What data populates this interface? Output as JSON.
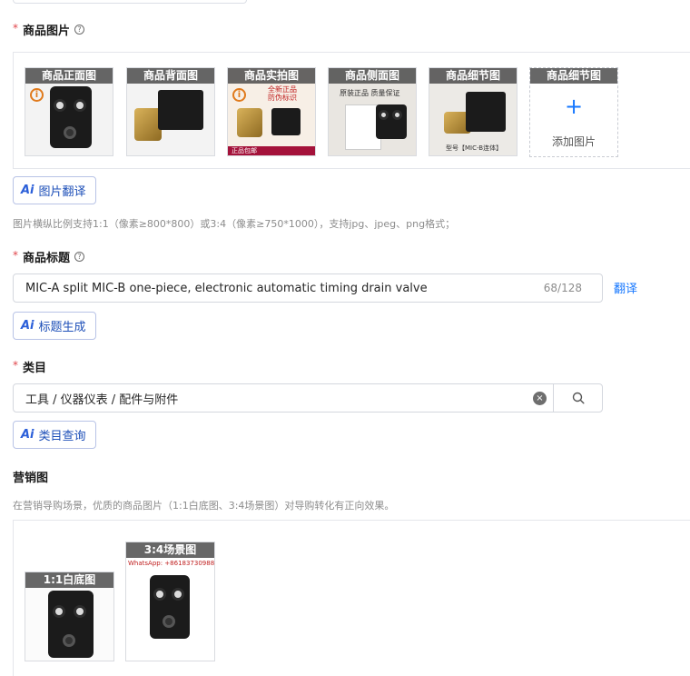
{
  "product_images": {
    "label": "商品图片",
    "required_mark": "*",
    "thumbs": [
      {
        "tag": "商品正面图"
      },
      {
        "tag": "商品背面图"
      },
      {
        "tag": "商品实拍图",
        "overlay_lines": [
          "全新正品",
          "防伪标识"
        ],
        "footer": "正品包邮"
      },
      {
        "tag": "商品侧面图",
        "overlay_line": "原装正品 质量保证"
      },
      {
        "tag": "商品细节图",
        "model_text": "型号【MIC-B连体】"
      }
    ],
    "add_slot": {
      "tag": "商品细节图",
      "plus": "+",
      "label": "添加图片"
    },
    "translate_button": "图片翻译",
    "hint": "图片横纵比例支持1:1（像素≥800*800）或3:4（像素≥750*1000），支持jpg、jpeg、png格式；"
  },
  "title_field": {
    "label": "商品标题",
    "required_mark": "*",
    "value": "MIC-A split MIC-B one-piece, electronic automatic timing drain valve",
    "counter": "68/128",
    "translate_link": "翻译",
    "generate_button": "标题生成"
  },
  "category_field": {
    "label": "类目",
    "required_mark": "*",
    "value": "工具 / 仪器仪表 / 配件与附件",
    "query_button": "类目查询"
  },
  "marketing": {
    "label": "营销图",
    "hint": "在营销导购场景，优质的商品图片（1:1白底图、3:4场景图）对导购转化有正向效果。",
    "images": [
      {
        "tag": "1:1白底图"
      },
      {
        "tag": "3:4场景图",
        "caption": "WhatsApp: +8618373098865"
      }
    ]
  },
  "ai_mark": "Ai",
  "help_mark": "?",
  "info_mark": "i",
  "clear_mark": "×",
  "colors": {
    "accent": "#1677ff",
    "required": "#e0454b",
    "ai_text": "#1d4fb8",
    "warning": "#e07a1c"
  }
}
